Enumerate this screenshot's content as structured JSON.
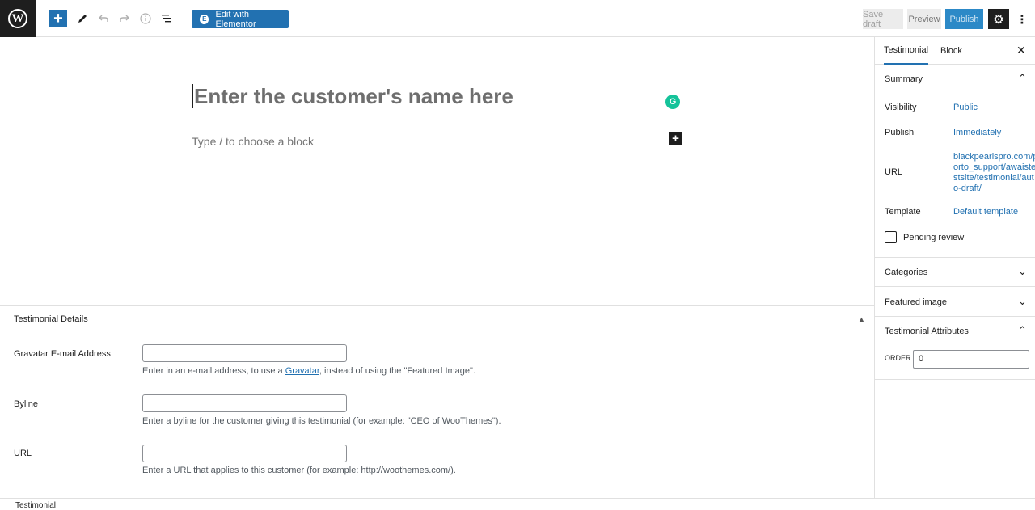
{
  "toolbar": {
    "add_icon": "plus-icon",
    "edit_with_elementor": "Edit with Elementor",
    "save_draft": "Save draft",
    "preview": "Preview",
    "publish": "Publish"
  },
  "editor": {
    "title_placeholder": "Enter the customer's name here",
    "block_placeholder": "Type / to choose a block"
  },
  "metabox": {
    "title": "Testimonial Details",
    "fields": [
      {
        "label": "Gravatar E-mail Address",
        "desc_before": "Enter in an e-mail address, to use a ",
        "desc_link": "Gravatar",
        "desc_after": ", instead of using the \"Featured Image\"."
      },
      {
        "label": "Byline",
        "desc": "Enter a byline for the customer giving this testimonial (for example: \"CEO of WooThemes\")."
      },
      {
        "label": "URL",
        "desc": "Enter a URL that applies to this customer (for example: http://woothemes.com/)."
      }
    ]
  },
  "footer": {
    "breadcrumb": "Testimonial"
  },
  "sidebar": {
    "tabs": [
      "Testimonial",
      "Block"
    ],
    "summary": {
      "title": "Summary",
      "visibility_label": "Visibility",
      "visibility_value": "Public",
      "publish_label": "Publish",
      "publish_value": "Immediately",
      "url_label": "URL",
      "url_value_lines": [
        "blackpearlspro.com/p",
        "orto_support/awaiste",
        "stsite/testimonial/aut",
        "o-draft/"
      ],
      "template_label": "Template",
      "template_value": "Default template",
      "pending_review": "Pending review"
    },
    "categories": "Categories",
    "featured_image": "Featured image",
    "attributes": {
      "title": "Testimonial Attributes",
      "order_label": "ORDER",
      "order_value": "0"
    }
  },
  "colors": {
    "accent": "#2271b1",
    "dark": "#1e1e1e",
    "grammarly": "#15c39a"
  }
}
